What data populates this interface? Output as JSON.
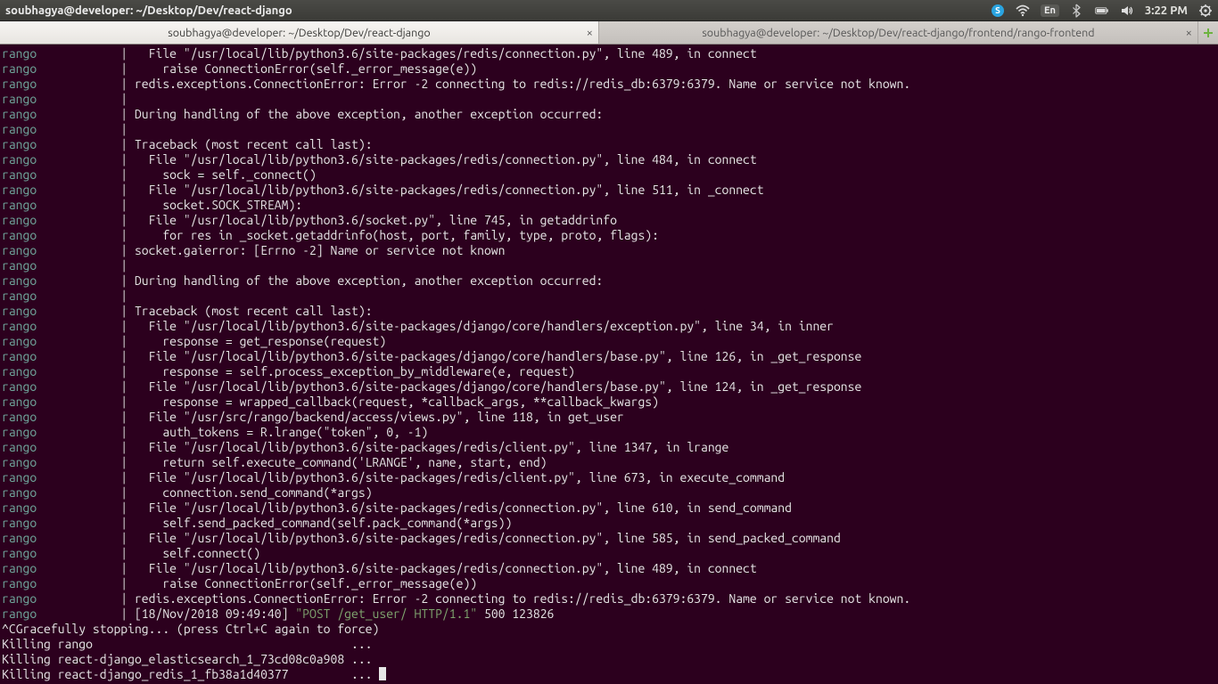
{
  "panel": {
    "window_title": "soubhagya@developer: ~/Desktop/Dev/react-django",
    "lang_indicator": "En",
    "clock": "3:22 PM"
  },
  "tabs": {
    "active_label": "soubhagya@developer: ~/Desktop/Dev/react-django",
    "inactive_label": "soubhagya@developer: ~/Desktop/Dev/react-django/frontend/rango-frontend"
  },
  "terminal": {
    "prefix": "rango",
    "pipe": "            | ",
    "lines": [
      "  File \"/usr/local/lib/python3.6/site-packages/redis/connection.py\", line 489, in connect",
      "    raise ConnectionError(self._error_message(e))",
      "redis.exceptions.ConnectionError: Error -2 connecting to redis://redis_db:6379:6379. Name or service not known.",
      "",
      "During handling of the above exception, another exception occurred:",
      "",
      "Traceback (most recent call last):",
      "  File \"/usr/local/lib/python3.6/site-packages/redis/connection.py\", line 484, in connect",
      "    sock = self._connect()",
      "  File \"/usr/local/lib/python3.6/site-packages/redis/connection.py\", line 511, in _connect",
      "    socket.SOCK_STREAM):",
      "  File \"/usr/local/lib/python3.6/socket.py\", line 745, in getaddrinfo",
      "    for res in _socket.getaddrinfo(host, port, family, type, proto, flags):",
      "socket.gaierror: [Errno -2] Name or service not known",
      "",
      "During handling of the above exception, another exception occurred:",
      "",
      "Traceback (most recent call last):",
      "  File \"/usr/local/lib/python3.6/site-packages/django/core/handlers/exception.py\", line 34, in inner",
      "    response = get_response(request)",
      "  File \"/usr/local/lib/python3.6/site-packages/django/core/handlers/base.py\", line 126, in _get_response",
      "    response = self.process_exception_by_middleware(e, request)",
      "  File \"/usr/local/lib/python3.6/site-packages/django/core/handlers/base.py\", line 124, in _get_response",
      "    response = wrapped_callback(request, *callback_args, **callback_kwargs)",
      "  File \"/usr/src/rango/backend/access/views.py\", line 118, in get_user",
      "    auth_tokens = R.lrange(\"token\", 0, -1)",
      "  File \"/usr/local/lib/python3.6/site-packages/redis/client.py\", line 1347, in lrange",
      "    return self.execute_command('LRANGE', name, start, end)",
      "  File \"/usr/local/lib/python3.6/site-packages/redis/client.py\", line 673, in execute_command",
      "    connection.send_command(*args)",
      "  File \"/usr/local/lib/python3.6/site-packages/redis/connection.py\", line 610, in send_command",
      "    self.send_packed_command(self.pack_command(*args))",
      "  File \"/usr/local/lib/python3.6/site-packages/redis/connection.py\", line 585, in send_packed_command",
      "    self.connect()",
      "  File \"/usr/local/lib/python3.6/site-packages/redis/connection.py\", line 489, in connect",
      "    raise ConnectionError(self._error_message(e))",
      "redis.exceptions.ConnectionError: Error -2 connecting to redis://redis_db:6379:6379. Name or service not known."
    ],
    "http_line_ts": "[18/Nov/2018 09:49:40] ",
    "http_line_quoted": "\"POST /get_user/ HTTP/1.1\"",
    "http_line_tail": " 500 123826",
    "stop_line": "^CGracefully stopping... (press Ctrl+C again to force)",
    "kill_lines": [
      "Killing rango                                     ... ",
      "Killing react-django_elasticsearch_1_73cd08c0a908 ... ",
      "Killing react-django_redis_1_fb38a1d40377         ... "
    ]
  }
}
